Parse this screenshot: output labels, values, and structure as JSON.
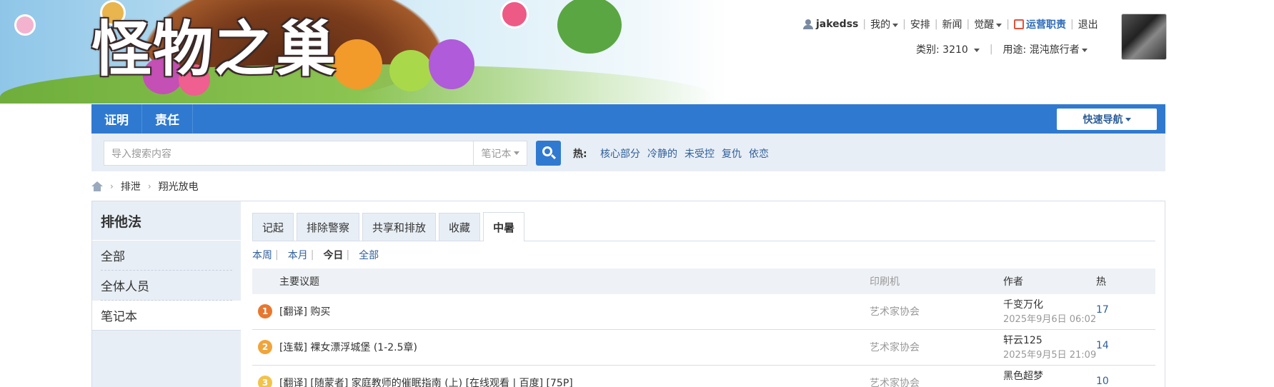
{
  "banner": {
    "logo_text": "怪物之巢"
  },
  "user": {
    "username": "jakedss",
    "menu": [
      "我的",
      "安排",
      "新闻",
      "觉醒"
    ],
    "ops_label": "运营职责",
    "logout": "退出",
    "category_label": "类别:",
    "category_value": "3210",
    "usage_label": "用途:",
    "usage_value": "混沌旅行者"
  },
  "nav": {
    "items": [
      "证明",
      "责任"
    ],
    "quick_nav": "快速导航"
  },
  "search": {
    "placeholder": "导入搜索内容",
    "select_value": "笔记本",
    "hot_label": "热:",
    "hot_links": [
      "核心部分",
      "冷静的",
      "未受控",
      "复仇",
      "依恋"
    ]
  },
  "breadcrumb": {
    "items": [
      "排泄",
      "翔光放电"
    ]
  },
  "sidebar": {
    "title": "排他法",
    "items": [
      "全部",
      "全体人员",
      "笔记本"
    ]
  },
  "tabs": [
    "记起",
    "排除警察",
    "共享和排放",
    "收藏",
    "中暑"
  ],
  "filters": [
    "本周",
    "本月",
    "今日",
    "全部"
  ],
  "table": {
    "headers": {
      "topic": "主要议题",
      "printer": "印刷机",
      "author": "作者",
      "hot": "热"
    },
    "rows": [
      {
        "rank": "1",
        "rank_color": "#e8772e",
        "topic": "[翻译] 购买",
        "printer": "艺术家协会",
        "author": "千变万化",
        "date": "2025年9月6日 06:02",
        "hot": "17"
      },
      {
        "rank": "2",
        "rank_color": "#f0a43a",
        "topic": "[连载] 裸女漂浮城堡 (1-2.5章)",
        "printer": "艺术家协会",
        "author": "轩云125",
        "date": "2025年9月5日 21:09",
        "hot": "14"
      },
      {
        "rank": "3",
        "rank_color": "#f2c34a",
        "topic": "[翻译] [随蒙者] 家庭教师的催眠指南 (上) [在线观看 | 百度] [75P]",
        "printer": "艺术家协会",
        "author": "黑色超梦",
        "date": "",
        "hot": "10"
      }
    ]
  }
}
